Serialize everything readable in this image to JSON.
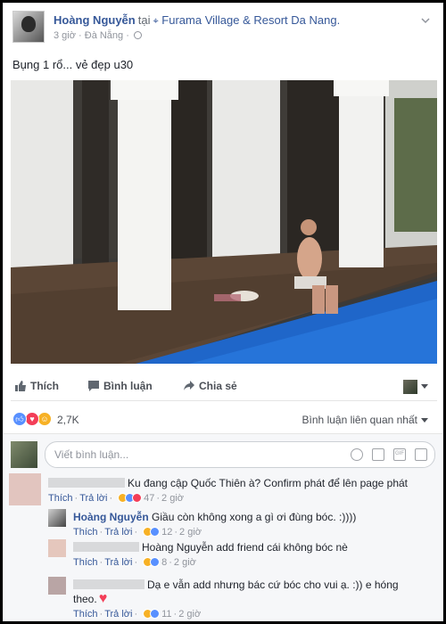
{
  "post": {
    "author": "Hoàng Nguyễn",
    "at_word": "tại",
    "location": "Furama Village & Resort Da Nang.",
    "time": "3 giờ",
    "city": "Đà Nẵng",
    "caption": "Bụng 1 rổ... vẻ đẹp u30"
  },
  "actions": {
    "like": "Thích",
    "comment": "Bình luận",
    "share": "Chia sẻ"
  },
  "reactions": {
    "count": "2,7K",
    "sort_label": "Bình luận liên quan nhất",
    "colors": {
      "like": "#5890ff",
      "love": "#f33e58",
      "haha": "#f7b125"
    }
  },
  "composer": {
    "placeholder": "Viết bình luận..."
  },
  "comments": [
    {
      "text": "Ku đang cập Quốc Thiên à? Confirm phát để lên page phát",
      "like": "Thích",
      "reply": "Trả lời",
      "count": "47",
      "time": "2 giờ"
    },
    {
      "author": "Hoàng Nguyễn",
      "text": "Giầu còn không xong a gì ơi đùng bóc. :))))",
      "like": "Thích",
      "reply": "Trả lời",
      "count": "12",
      "time": "2 giờ"
    },
    {
      "text": "Hoàng Nguyễn add friend cái không bóc nè",
      "like": "Thích",
      "reply": "Trả lời",
      "count": "8",
      "time": "2 giờ"
    },
    {
      "text_line1": "Dạ e vẫn add nhưng bác cứ bóc cho vui ạ. :)) e hóng",
      "text_line2": "theo.",
      "like": "Thích",
      "reply": "Trả lời",
      "count": "11",
      "time": "2 giờ"
    }
  ]
}
